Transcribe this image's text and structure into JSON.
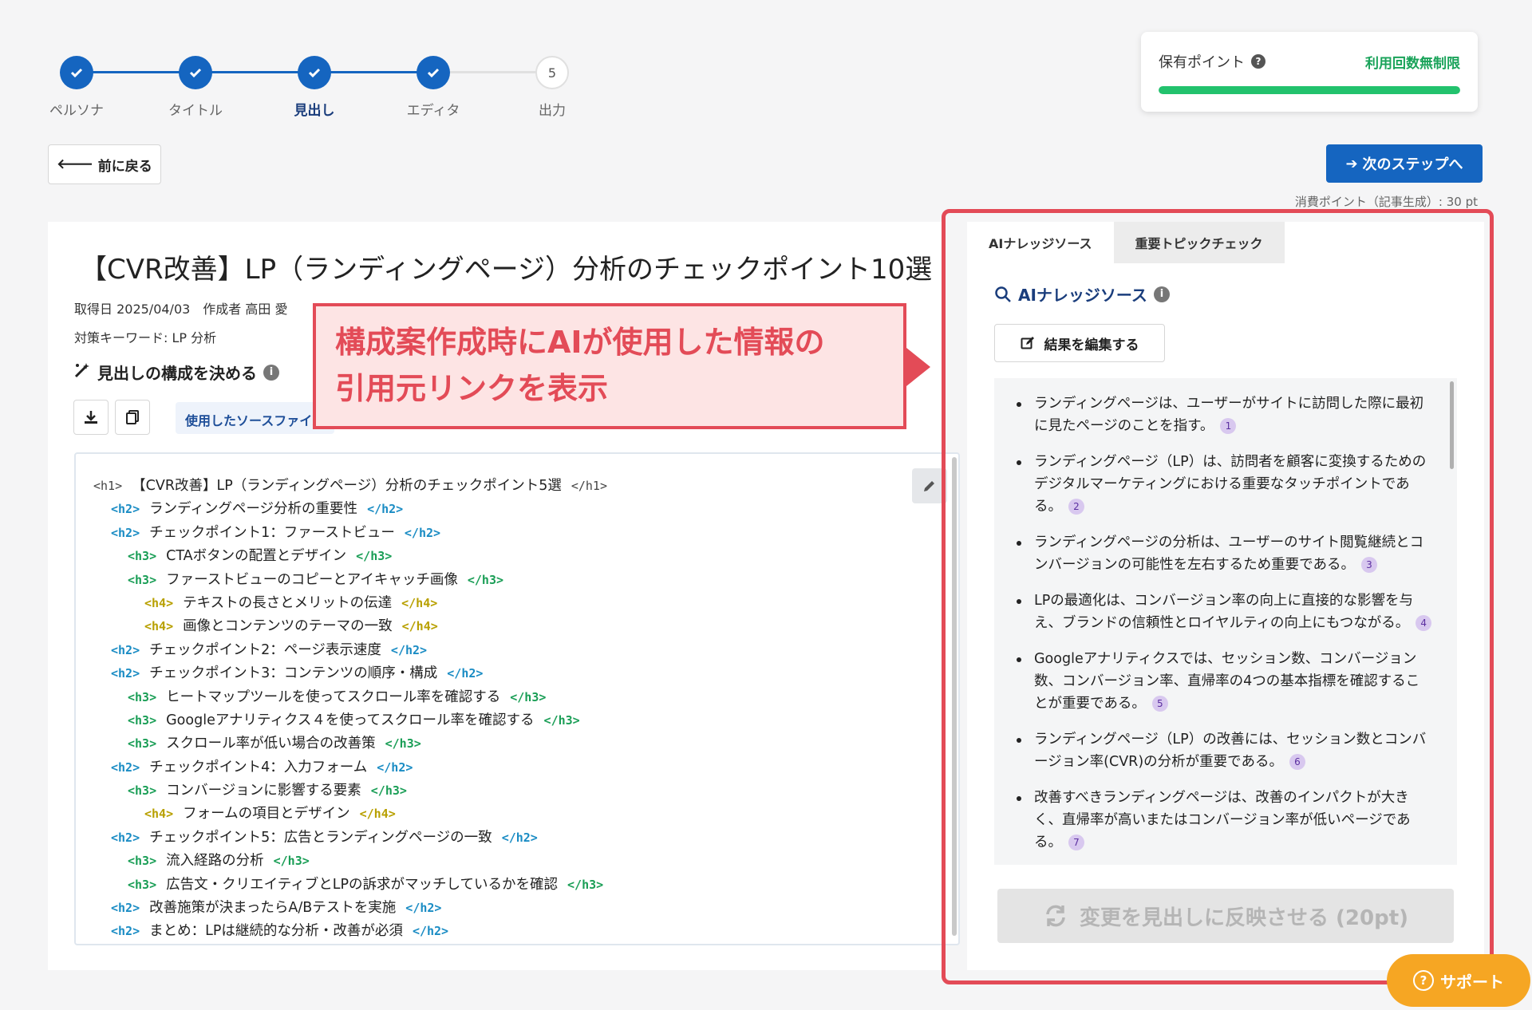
{
  "stepper": {
    "steps": [
      {
        "label": "ペルソナ",
        "state": "done"
      },
      {
        "label": "タイトル",
        "state": "done"
      },
      {
        "label": "見出し",
        "state": "done",
        "active": true
      },
      {
        "label": "エディタ",
        "state": "done"
      },
      {
        "label": "出力",
        "state": "pending",
        "number": "5"
      }
    ]
  },
  "points": {
    "title": "保有ポイント",
    "status": "利用回数無制限",
    "fill_fraction": 1.0
  },
  "nav": {
    "back_label": "前に戻る",
    "next_label": "次のステップへ",
    "consume_text": "消費ポイント（記事生成）: 30 pt"
  },
  "article": {
    "title": "【CVR改善】LP（ランディングページ）分析のチェックポイント10選",
    "meta_line": "取得日 2025/04/03　作成者 高田 愛",
    "keyword_line": "対策キーワード: LP 分析",
    "section_heading": "見出しの構成を決める",
    "source_tag": "使用したソースファイル"
  },
  "outline": [
    {
      "level": "h1",
      "text": "【CVR改善】LP（ランディングページ）分析のチェックポイント5選"
    },
    {
      "level": "h2",
      "text": "ランディングページ分析の重要性"
    },
    {
      "level": "h2",
      "text": "チェックポイント1：ファーストビュー"
    },
    {
      "level": "h3",
      "text": "CTAボタンの配置とデザイン"
    },
    {
      "level": "h3",
      "text": "ファーストビューのコピーとアイキャッチ画像"
    },
    {
      "level": "h4",
      "text": "テキストの長さとメリットの伝達"
    },
    {
      "level": "h4",
      "text": "画像とコンテンツのテーマの一致"
    },
    {
      "level": "h2",
      "text": "チェックポイント2：ページ表示速度"
    },
    {
      "level": "h2",
      "text": "チェックポイント3：コンテンツの順序・構成"
    },
    {
      "level": "h3",
      "text": "ヒートマップツールを使ってスクロール率を確認する"
    },
    {
      "level": "h3",
      "text": "Googleアナリティクス４を使ってスクロール率を確認する"
    },
    {
      "level": "h3",
      "text": "スクロール率が低い場合の改善策"
    },
    {
      "level": "h2",
      "text": "チェックポイント4：入力フォーム"
    },
    {
      "level": "h3",
      "text": "コンバージョンに影響する要素"
    },
    {
      "level": "h4",
      "text": "フォームの項目とデザイン"
    },
    {
      "level": "h2",
      "text": "チェックポイント5：広告とランディングページの一致"
    },
    {
      "level": "h3",
      "text": "流入経路の分析"
    },
    {
      "level": "h3",
      "text": "広告文・クリエイティブとLPの訴求がマッチしているかを確認"
    },
    {
      "level": "h2",
      "text": "改善施策が決まったらA/Bテストを実施"
    },
    {
      "level": "h2",
      "text": "まとめ：LPは継続的な分析・改善が必須"
    }
  ],
  "right": {
    "tabs": [
      "AIナレッジソース",
      "重要トピックチェック"
    ],
    "heading": "AIナレッジソース",
    "edit_label": "結果を編集する",
    "items": [
      {
        "text": "ランディングページは、ユーザーがサイトに訪問した際に最初に見たページのことを指す。",
        "cite": "1"
      },
      {
        "text": "ランディングページ（LP）は、訪問者を顧客に変換するためのデジタルマーケティングにおける重要なタッチポイントである。",
        "cite": "2"
      },
      {
        "text": "ランディングページの分析は、ユーザーのサイト閲覧継続とコンバージョンの可能性を左右するため重要である。",
        "cite": "3"
      },
      {
        "text": "LPの最適化は、コンバージョン率の向上に直接的な影響を与え、ブランドの信頼性とロイヤルティの向上にもつながる。",
        "cite": "4"
      },
      {
        "text": "Googleアナリティクスでは、セッション数、コンバージョン数、コンバージョン率、直帰率の4つの基本指標を確認することが重要である。",
        "cite": "5"
      },
      {
        "text": "ランディングページ（LP）の改善には、セッション数とコンバージョン率(CVR)の分析が重要である。",
        "cite": "6"
      },
      {
        "text": "改善すべきランディングページは、改善のインパクトが大きく、直帰率が高いまたはコンバージョン率が低いページである。",
        "cite": "7"
      }
    ],
    "apply_label": "変更を見出しに反映させる (20pt)"
  },
  "annotation": {
    "line1": "構成案作成時にAIが使用した情報の",
    "line2": "引用元リンクを表示"
  },
  "support_label": "サポート",
  "colors": {
    "primary": "#1565c0",
    "success": "#22c26d",
    "annotation": "#e34b57",
    "support": "#f6a623"
  }
}
